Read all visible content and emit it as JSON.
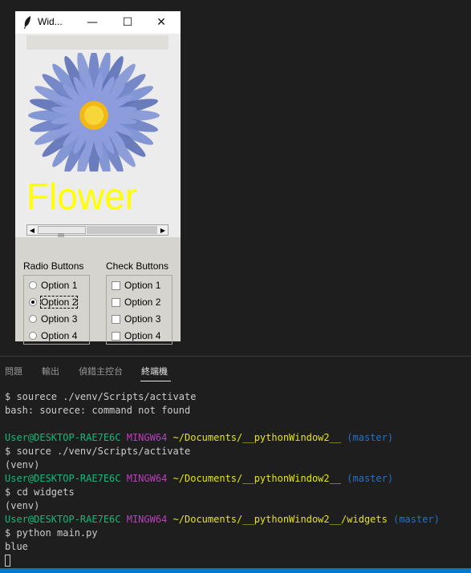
{
  "tk_window": {
    "title": "Wid...",
    "minimize": "—",
    "maximize": "☐",
    "close": "✕",
    "flower_text": "Flower",
    "radio_group": {
      "title": "Radio Buttons",
      "options": [
        "Option 1",
        "Option 2",
        "Option 3",
        "Option 4"
      ],
      "selected": "Option 2"
    },
    "check_group": {
      "title": "Check Buttons",
      "options": [
        "Option 1",
        "Option 2",
        "Option 3",
        "Option 4"
      ]
    },
    "colors": {
      "flower_text": "#ffff00",
      "petals": "#6b7fc4",
      "center": "#f2c21b"
    }
  },
  "panel": {
    "tabs": [
      "問題",
      "輸出",
      "偵錯主控台",
      "終端機"
    ],
    "active_tab": "終端機"
  },
  "terminal": {
    "l1": "$ sourece ./venv/Scripts/activate",
    "l2": "bash: sourece: command not found",
    "p1_user": "User@DESKTOP-RAE7E6C",
    "p1_sys": "MINGW64",
    "p1_path": "~/Documents/__pythonWindow2__",
    "p1_branch": "(master)",
    "l4": "$ source ./venv/Scripts/activate",
    "l5": "(venv)",
    "p2_user": "User@DESKTOP-RAE7E6C",
    "p2_sys": "MINGW64",
    "p2_path": "~/Documents/__pythonWindow2__",
    "p2_branch": "(master)",
    "l7": "$ cd widgets",
    "l8": "(venv)",
    "p3_user": "User@DESKTOP-RAE7E6C",
    "p3_sys": "MINGW64",
    "p3_path": "~/Documents/__pythonWindow2__/widgets",
    "p3_branch": "(master)",
    "l10": "$ python main.py",
    "l11": "blue"
  }
}
